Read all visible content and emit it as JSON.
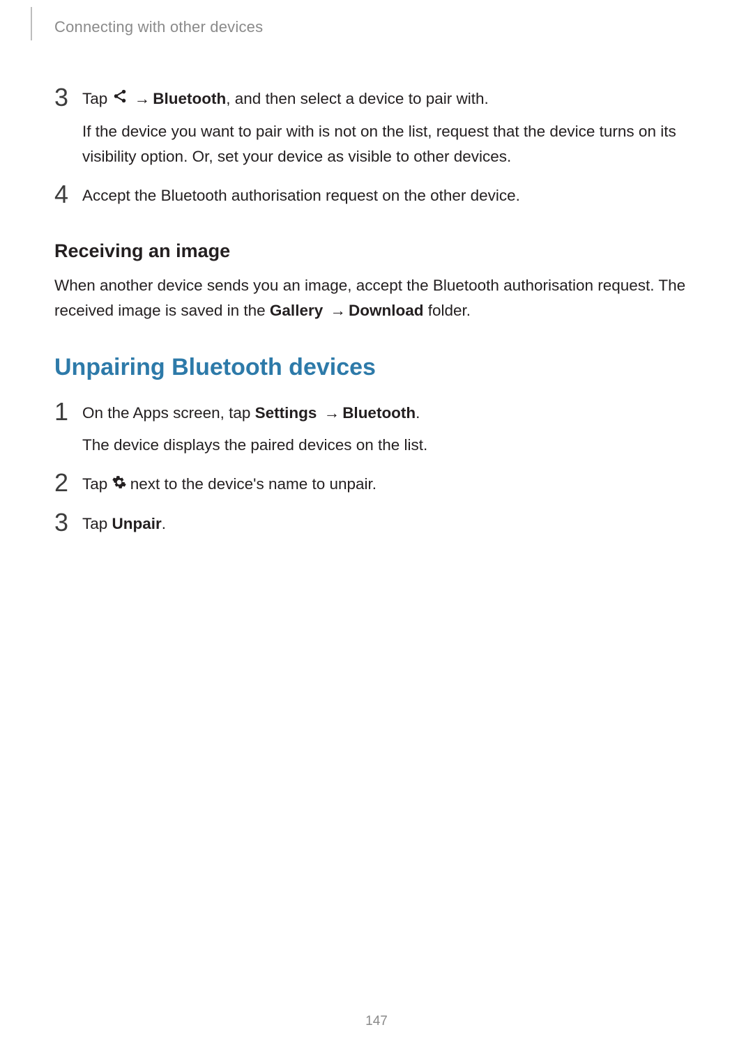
{
  "header": {
    "section_title": "Connecting with other devices"
  },
  "steps_a": [
    {
      "num": "3",
      "line1_a": "Tap ",
      "line1_bold": "Bluetooth",
      "line1_b": ", and then select a device to pair with.",
      "sub": "If the device you want to pair with is not on the list, request that the device turns on its visibility option. Or, set your device as visible to other devices."
    },
    {
      "num": "4",
      "line1": "Accept the Bluetooth authorisation request on the other device."
    }
  ],
  "h3_receiving": "Receiving an image",
  "para_receiving_a": "When another device sends you an image, accept the Bluetooth authorisation request. The received image is saved in the ",
  "para_receiving_gallery": "Gallery",
  "para_receiving_download": "Download",
  "para_receiving_c": " folder.",
  "h2_unpair": "Unpairing Bluetooth devices",
  "steps_b": [
    {
      "num": "1",
      "line1_a": "On the Apps screen, tap ",
      "line1_settings": "Settings",
      "line1_bluetooth": "Bluetooth",
      "line1_c": ".",
      "sub": "The device displays the paired devices on the list."
    },
    {
      "num": "2",
      "line1_a": "Tap ",
      "line1_b": " next to the device's name to unpair."
    },
    {
      "num": "3",
      "line1_a": "Tap ",
      "line1_unpair": "Unpair",
      "line1_c": "."
    }
  ],
  "arrow": "→",
  "page_number": "147"
}
